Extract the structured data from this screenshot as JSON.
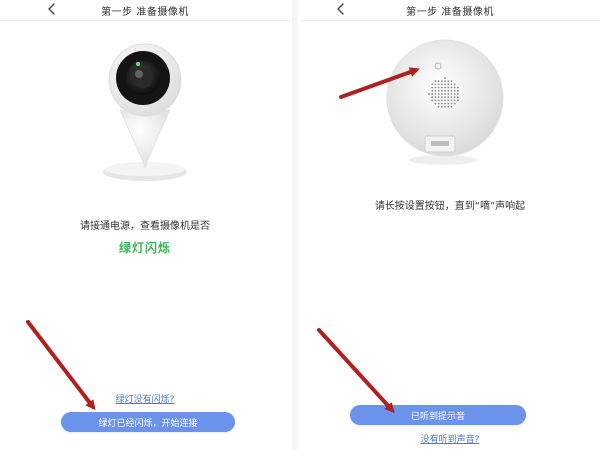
{
  "steps": [
    {
      "title": "第一步 准备摄像机",
      "instruction": "请接通电源，查看摄像机是否",
      "highlight": "绿灯闪烁",
      "link": "绿灯没有闪烁?",
      "button": "绿灯已经闪烁，开始连接"
    },
    {
      "title": "第一步 准备摄像机",
      "instruction": "请长按设置按钮，直到“嘀”声响起",
      "button": "已听到提示音",
      "link": "没有听到声音?"
    }
  ],
  "colors": {
    "accent": "#6b93ec",
    "green": "#41b35a",
    "link": "#4b78d9",
    "arrow": "#b0201f"
  },
  "icons": {
    "back": "chevron-left-icon",
    "arrow": "red-arrow-annotation"
  }
}
